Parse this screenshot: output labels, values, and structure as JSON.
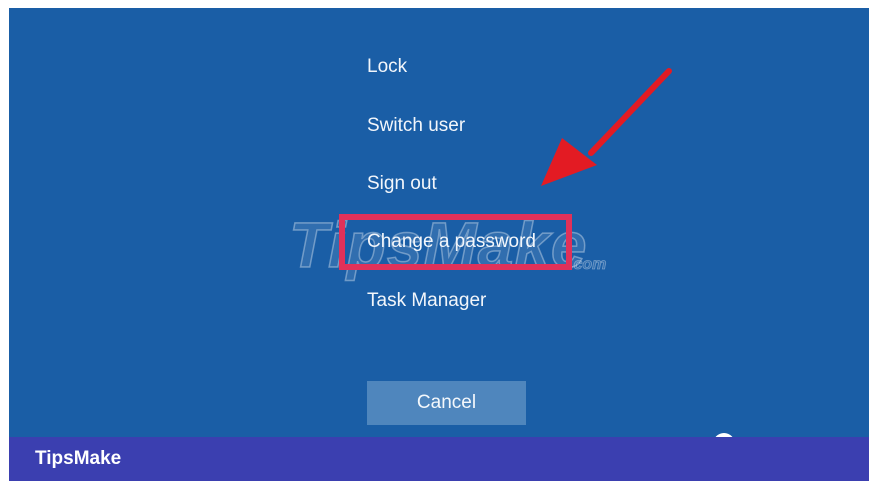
{
  "menu": {
    "items": [
      {
        "label": "Lock"
      },
      {
        "label": "Switch user"
      },
      {
        "label": "Sign out"
      },
      {
        "label": "Change a password"
      },
      {
        "label": "Task Manager"
      }
    ],
    "highlighted_item": "Change a password"
  },
  "cancel": {
    "label": "Cancel"
  },
  "watermark": {
    "text": "TipsMake",
    "suffix": ".com"
  },
  "brand": {
    "label": "TipsMake"
  },
  "colors": {
    "screen_background": "#1a5ea6",
    "cancel_button": "#4f86bd",
    "highlight_box": "#e0315a",
    "arrow": "#e31b23",
    "brand_bar": "#3b3fb0"
  },
  "icons": {
    "annotation_arrow": "arrow-icon",
    "corner": "circle-icon"
  }
}
